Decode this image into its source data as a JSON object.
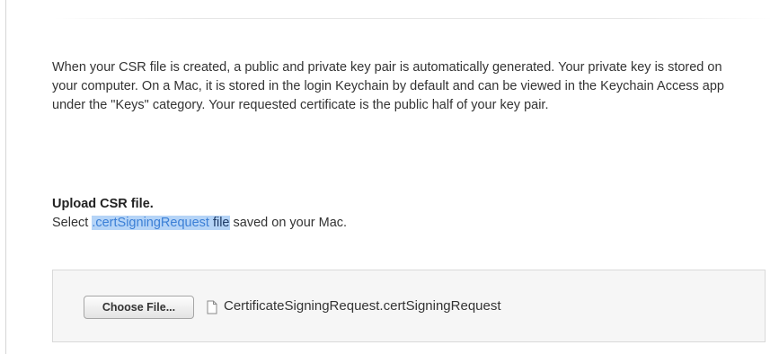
{
  "intro": {
    "text": "When your CSR file is created, a public and private key pair is automatically generated. Your private key is stored on your computer. On a Mac, it is stored in the login Keychain by default and can be viewed in the Keychain Access app under the \"Keys\" category. Your requested certificate is the public half of your key pair."
  },
  "upload": {
    "title": "Upload CSR file.",
    "instruction_prefix": "Select ",
    "instruction_highlight_ext": ".certSigningRequest",
    "instruction_highlight_file": " file",
    "instruction_suffix": " saved on your Mac.",
    "choose_button_label": "Choose File...",
    "selected_file_name": "CertificateSigningRequest.certSigningRequest"
  },
  "icons": {
    "file": "document-icon"
  },
  "colors": {
    "highlight_background": "#b5d4f7",
    "highlight_text": "#3b7fd6",
    "upload_box_background": "#f6f6f6"
  }
}
